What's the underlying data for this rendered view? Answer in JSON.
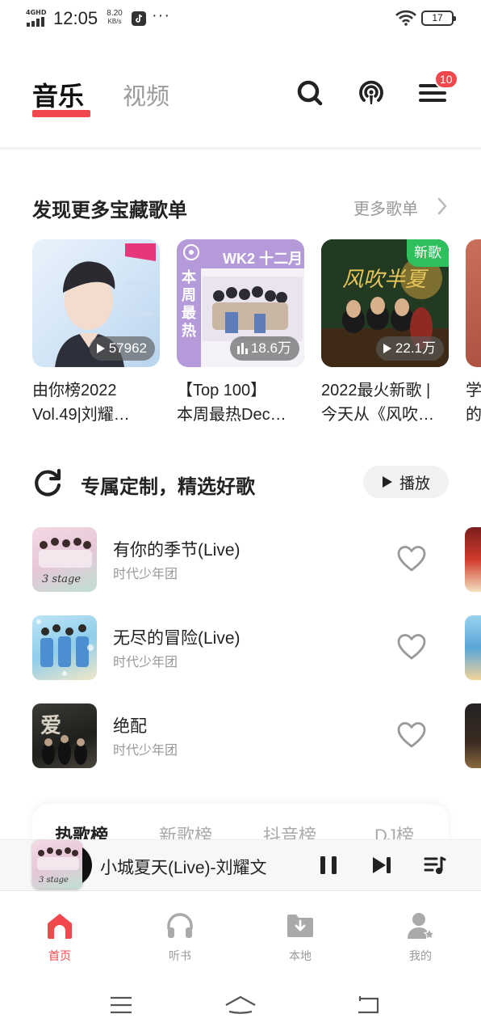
{
  "status_bar": {
    "network": "4GHD",
    "time": "12:05",
    "speed_value": "8.20",
    "speed_unit": "KB/s",
    "overflow": "···",
    "battery": "17"
  },
  "header": {
    "tabs": [
      {
        "label": "音乐",
        "active": true
      },
      {
        "label": "视频",
        "active": false
      }
    ],
    "icons": [
      "search-icon",
      "podcast-icon",
      "menu-icon"
    ],
    "badge_count": "10",
    "accent_color": "#f0484c"
  },
  "discover": {
    "title": "发现更多宝藏歌单",
    "more_label": "更多歌单",
    "playlists": [
      {
        "play_count": "57962",
        "count_icon": "play-icon",
        "line1": "由你榜2022",
        "line2": "Vol.49|刘耀…"
      },
      {
        "play_count": "18.6万",
        "count_icon": "bars-icon",
        "cover_text": "WK2 十二月",
        "cover_side": "本周最热",
        "line1": "【Top 100】",
        "line2": "本周最热Dec…"
      },
      {
        "play_count": "22.1万",
        "count_icon": "play-icon",
        "tag": "新歌",
        "line1": "2022最火新歌 |",
        "line2": "今天从《风吹…"
      },
      {
        "line1": "学",
        "line2": "的"
      }
    ]
  },
  "custom": {
    "title": "专属定制，精选好歌",
    "play_label": "播放",
    "songs": [
      {
        "name": "有你的季节(Live)",
        "artist": "时代少年团"
      },
      {
        "name": "无尽的冒险(Live)",
        "artist": "时代少年团"
      },
      {
        "name": "绝配",
        "artist": "时代少年团"
      }
    ]
  },
  "charts": {
    "tabs": [
      "热歌榜",
      "新歌榜",
      "抖音榜",
      "DJ榜"
    ]
  },
  "mini_player": {
    "title": "小城夏天(Live)-刘耀文"
  },
  "bottom_nav": {
    "items": [
      {
        "label": "首页",
        "icon": "home-icon",
        "active": true
      },
      {
        "label": "听书",
        "icon": "headphones-icon",
        "active": false
      },
      {
        "label": "本地",
        "icon": "folder-download-icon",
        "active": false
      },
      {
        "label": "我的",
        "icon": "user-icon",
        "active": false
      }
    ]
  }
}
